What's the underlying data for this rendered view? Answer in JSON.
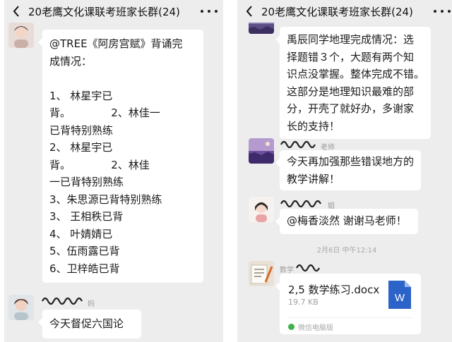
{
  "left": {
    "title": "20老鹰文化课联考班家长群(24)",
    "sender1_name": "",
    "message1_lines": [
      "@TREE《阿房宫赋》背诵完",
      "成情况：",
      "",
      "1、 林星宇已",
      "背。            2、林佳一",
      "已背特别熟练",
      "2、 林星宇已",
      "背。            2、林佳",
      "一已背特别熟练",
      "3、朱思源已背特别熟练",
      "3、 王相秩已背",
      "4、 叶婧婧已",
      "5、伍雨露已背",
      "6、卫梓皓已背"
    ],
    "sender2_name": "妈",
    "message2": "今天督促六国论"
  },
  "right": {
    "title": "20老鹰文化课联考班家长群(24)",
    "message1_lines": [
      "禹辰同学地理完成情况：选",
      "择题错３个，大题有两个知",
      "识点没掌握。整体完成不错。",
      "这部分是地理知识最难的部",
      "分，开壳了就好办，多谢家",
      "长的支持！"
    ],
    "sender2_name": "老师",
    "message2_lines": [
      "今天再加强那些错误地方的",
      "教学讲解！"
    ],
    "sender3_name": "姐",
    "message3": "@梅香淡然  谢谢马老师！",
    "timestamp": "2月6日 中午12:14",
    "sender4_name": "数学",
    "file": {
      "name": "2,5 数学练习.docx",
      "size": "19.7 KB",
      "icon_letter": "W",
      "source": "微信电脑版"
    }
  },
  "colors": {
    "chat_bg": "#ededed",
    "bubble_bg": "#ffffff",
    "word_blue": "#2b63c8",
    "source_green": "#3db14a"
  },
  "icons": [
    "back-arrow-icon",
    "more-icon",
    "word-file-icon",
    "wechat-pc-icon"
  ]
}
